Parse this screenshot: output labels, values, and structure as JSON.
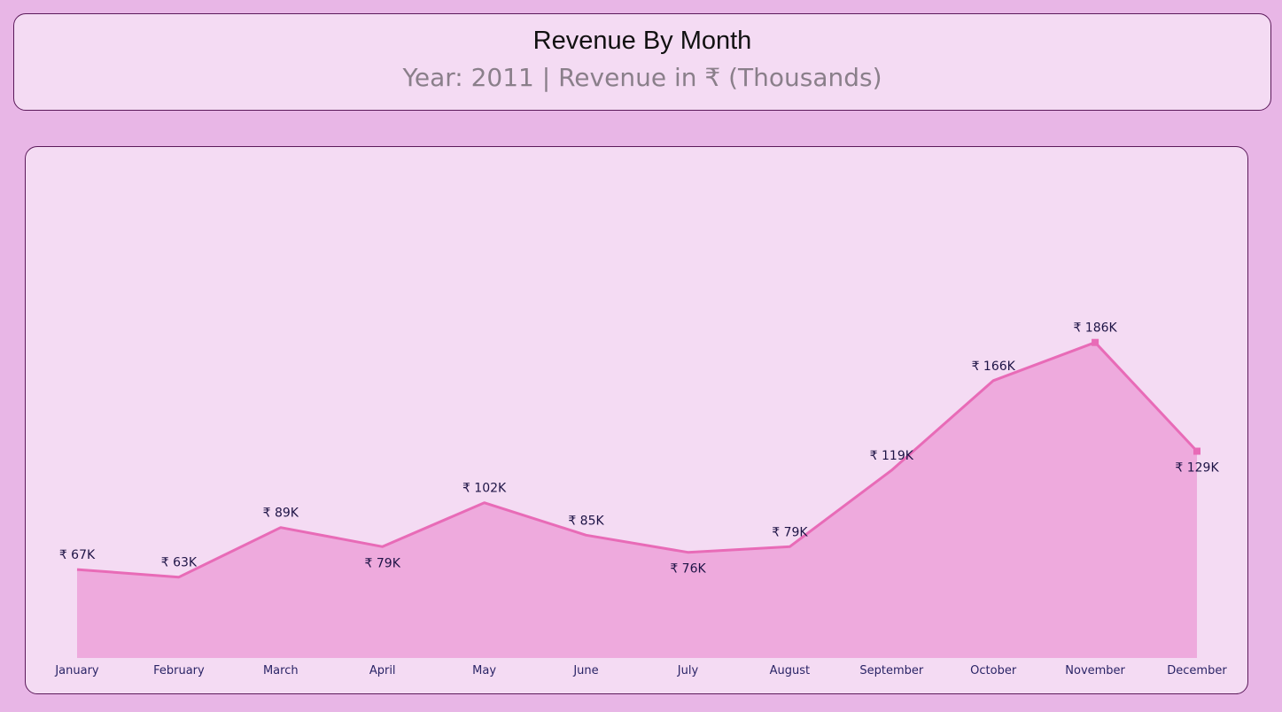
{
  "header": {
    "title": "Revenue By Month",
    "subtitle": "Year: 2011 | Revenue in ₹ (Thousands)"
  },
  "colors": {
    "page_background": "#e8b6e6",
    "card_background": "#f4dbf3",
    "card_border": "#5b1a5a",
    "line": "#e86bb7",
    "area_fill": "#eeaadd",
    "label_text": "#1e1446"
  },
  "chart_data": {
    "type": "area",
    "categories": [
      "January",
      "February",
      "March",
      "April",
      "May",
      "June",
      "July",
      "August",
      "September",
      "October",
      "November",
      "December"
    ],
    "values": [
      67,
      63,
      89,
      79,
      102,
      85,
      76,
      79,
      119,
      166,
      186,
      129
    ],
    "data_labels": [
      "₹ 67K",
      "₹ 63K",
      "₹ 89K",
      "₹ 79K",
      "₹ 102K",
      "₹ 85K",
      "₹ 76K",
      "₹ 79K",
      "₹ 119K",
      "₹ 166K",
      "₹ 186K",
      "₹ 129K"
    ],
    "markers": [
      "November",
      "December"
    ],
    "grid": false,
    "legend": "none",
    "y_axis_visible": false
  }
}
